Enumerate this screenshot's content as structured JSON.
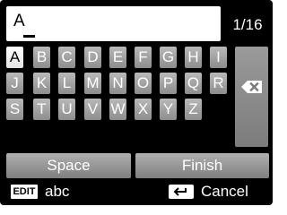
{
  "input": {
    "text": "A"
  },
  "counter": "1/16",
  "keys": {
    "row1": [
      "A",
      "B",
      "C",
      "D",
      "E",
      "F",
      "G",
      "H",
      "I"
    ],
    "row2": [
      "J",
      "K",
      "L",
      "M",
      "N",
      "O",
      "P",
      "Q",
      "R"
    ],
    "row3": [
      "S",
      "T",
      "U",
      "V",
      "W",
      "X",
      "Y",
      "Z"
    ]
  },
  "selected_key": "A",
  "buttons": {
    "space": "Space",
    "finish": "Finish"
  },
  "footer": {
    "edit_badge": "EDIT",
    "mode": "abc",
    "cancel": "Cancel"
  },
  "icons": {
    "backspace": "backspace-icon",
    "back": "return-arrow-icon"
  },
  "colors": {
    "key": "#a3a3a3",
    "selected_key": "#ffffff",
    "background": "#000000"
  }
}
